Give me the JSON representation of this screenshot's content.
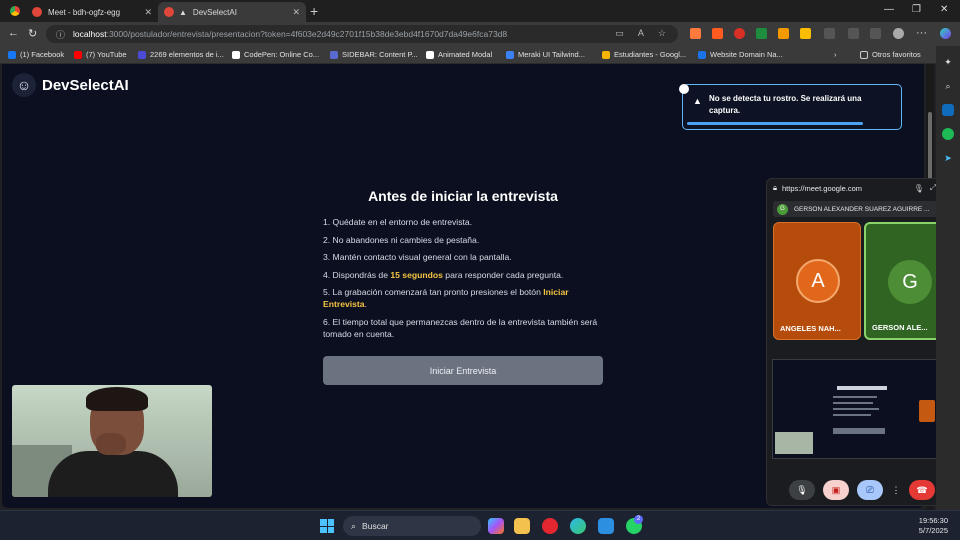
{
  "browser": {
    "tabs": [
      {
        "title": "Meet - bdh-ogfz-egg",
        "active": false
      },
      {
        "title": "DevSelectAI",
        "active": true
      }
    ],
    "url_host": "localhost",
    "url_path": ":3000/postulador/entrevista/presentacion?token=4f603e2d49c2701f15b38de3ebd4f1670d7da49e6fca73d8",
    "bookmarks": [
      "(1) Facebook",
      "(7) YouTube",
      "2269 elementos de i...",
      "CodePen: Online Co...",
      "SIDEBAR: Content P...",
      "Animated Modal",
      "Meraki UI Tailwind...",
      "Estudiantes - Googl...",
      "Website Domain Na...",
      "Otros favoritos"
    ]
  },
  "app": {
    "brand": "DevSelectAI",
    "heading": "Antes de iniciar la entrevista",
    "rules": {
      "r1": "1. Quédate en el entorno de entrevista.",
      "r2": "2. No abandones ni cambies de pestaña.",
      "r3": "3. Mantén contacto visual general con la pantalla.",
      "r4_pre": "4. Dispondrás de ",
      "r4_hl": "15 segundos",
      "r4_post": " para responder cada pregunta.",
      "r5_pre": "5. La grabación comenzará tan pronto presiones el botón ",
      "r5_hl": "Iniciar Entrevista",
      "r5_post": ".",
      "r6": "6. El tiempo total que permanezcas dentro de la entrevista también será tomado en cuenta."
    },
    "start_button": "Iniciar Entrevista",
    "toast": "No se detecta tu rostro. Se realizará una captura."
  },
  "meet_pip": {
    "url": "https://meet.google.com",
    "presenter_initial": "G",
    "presenter": "GERSON ALEXANDER SUAREZ AGUIRRE ...",
    "participants": [
      {
        "initial": "A",
        "name": "ANGELES NAH...",
        "color": "#c45a12"
      },
      {
        "initial": "G",
        "name": "GERSON ALE...",
        "color": "#3f7a2c"
      }
    ]
  },
  "taskbar": {
    "search": "Buscar",
    "time": "19:56:30",
    "date": "5/7/2025",
    "badge": "2"
  }
}
